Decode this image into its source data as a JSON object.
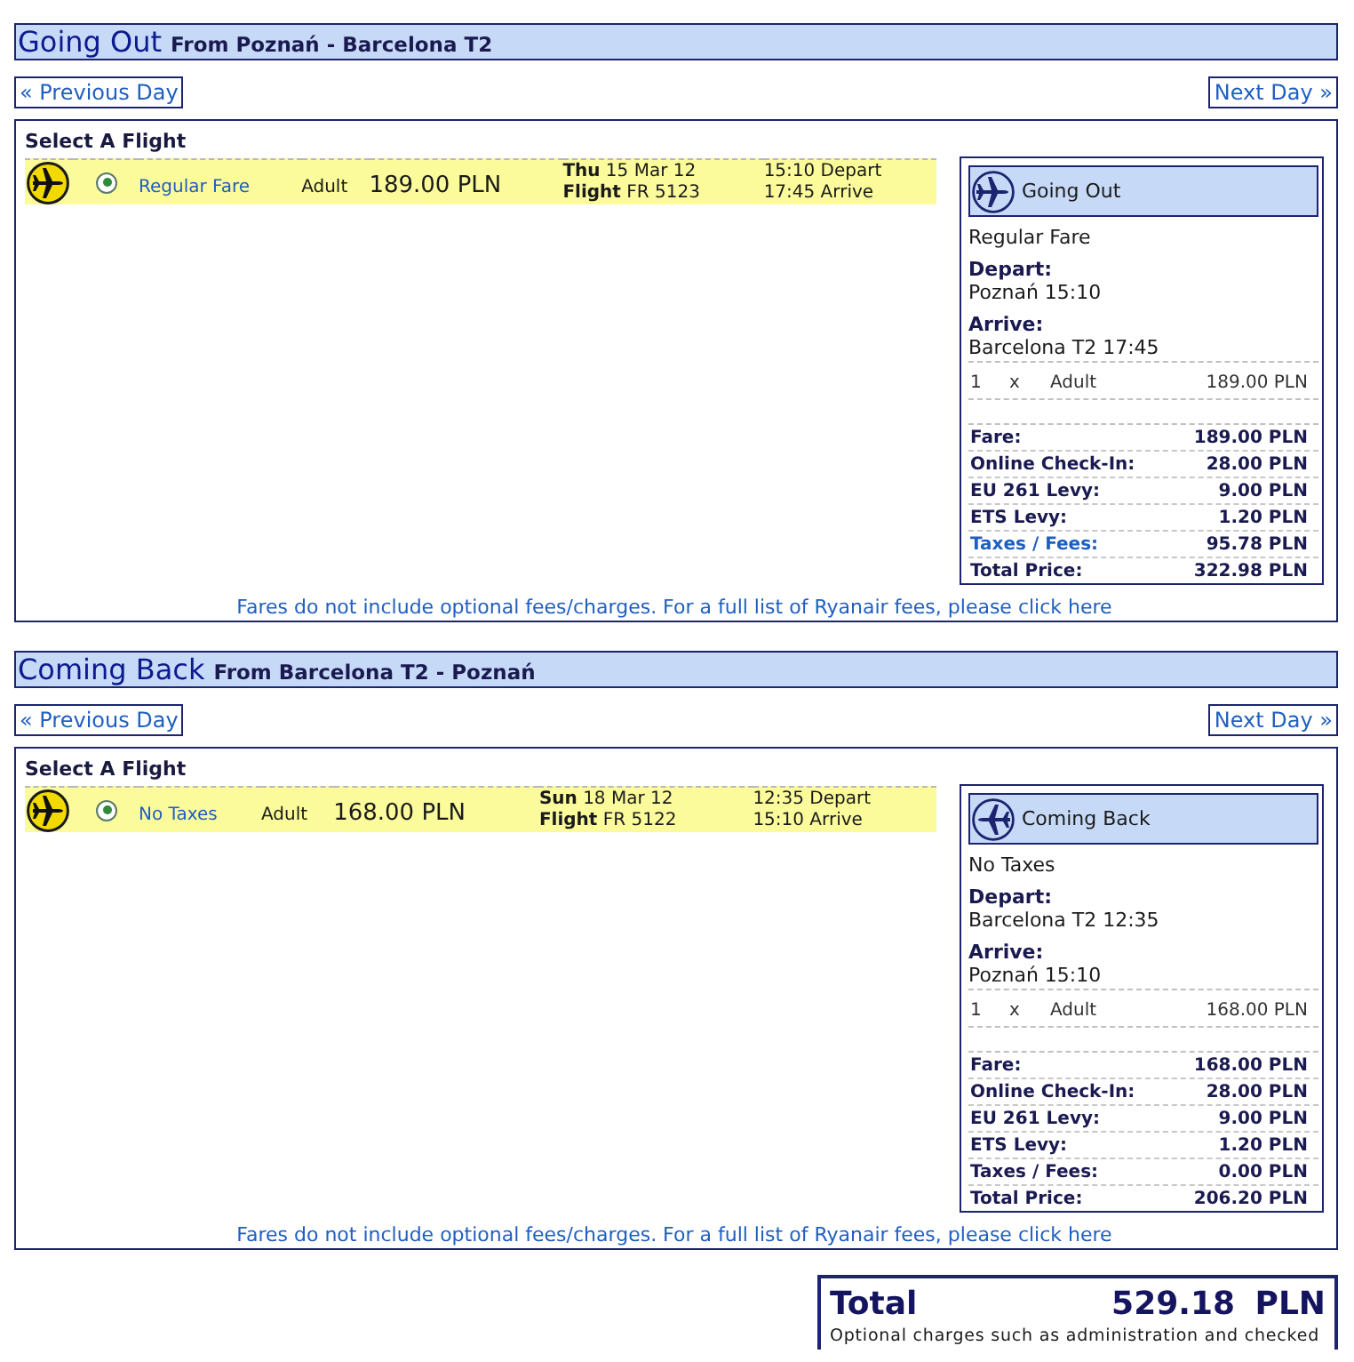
{
  "sections": [
    {
      "plane_mirrored": false,
      "title": "Going Out",
      "route": "From Poznań - Barcelona T2",
      "prev_day": "« Previous Day",
      "next_day": "Next Day »",
      "select_title": "Select A Flight",
      "flights": [
        {
          "selected": true,
          "fare": "Regular Fare",
          "passenger": "Adult",
          "price": "189.00 PLN",
          "date": "**Thu** 15 Mar 12",
          "flight": "**Flight** FR 5123",
          "depart": "15:10 Depart",
          "arrive": "17:45 Arrive"
        }
      ],
      "summary": {
        "title": "Going Out",
        "fare_type": "Regular Fare",
        "depart_label": "Depart:",
        "depart": "Poznań 15:10",
        "arrive_label": "Arrive:",
        "arrive": "Barcelona T2 17:45",
        "passengers": [
          {
            "count": "1",
            "times": "x",
            "type": "Adult",
            "price": "189.00 PLN"
          }
        ],
        "fees": [
          {
            "label": "Fare:",
            "value": "189.00 PLN",
            "link": false
          },
          {
            "label": "Online Check-In:",
            "value": "28.00 PLN",
            "link": false
          },
          {
            "label": "EU 261 Levy:",
            "value": "9.00 PLN",
            "link": false
          },
          {
            "label": "ETS Levy:",
            "value": "1.20 PLN",
            "link": false
          },
          {
            "label": "Taxes / Fees:",
            "value": "95.78 PLN",
            "link": true
          },
          {
            "label": "Total Price:",
            "value": "322.98 PLN",
            "link": false
          }
        ]
      },
      "notice": "Fares do not include optional fees/charges. For a full list of Ryanair fees, please click here"
    },
    {
      "plane_mirrored": true,
      "title": "Coming Back",
      "route": "From Barcelona T2 - Poznań",
      "prev_day": "« Previous Day",
      "next_day": "Next Day »",
      "select_title": "Select A Flight",
      "flights": [
        {
          "selected": true,
          "fare": "No Taxes",
          "passenger": "Adult",
          "price": "168.00 PLN",
          "date": "**Sun** 18 Mar 12",
          "flight": "**Flight** FR 5122",
          "depart": "12:35 Depart",
          "arrive": "15:10 Arrive"
        }
      ],
      "summary": {
        "title": "Coming Back",
        "fare_type": "No Taxes",
        "depart_label": "Depart:",
        "depart": "Barcelona T2 12:35",
        "arrive_label": "Arrive:",
        "arrive": "Poznań 15:10",
        "passengers": [
          {
            "count": "1",
            "times": "x",
            "type": "Adult",
            "price": "168.00 PLN"
          }
        ],
        "fees": [
          {
            "label": "Fare:",
            "value": "168.00 PLN",
            "link": false
          },
          {
            "label": "Online Check-In:",
            "value": "28.00 PLN",
            "link": false
          },
          {
            "label": "EU 261 Levy:",
            "value": "9.00 PLN",
            "link": false
          },
          {
            "label": "ETS Levy:",
            "value": "1.20 PLN",
            "link": false
          },
          {
            "label": "Taxes / Fees:",
            "value": "0.00 PLN",
            "link": false
          },
          {
            "label": "Total Price:",
            "value": "206.20 PLN",
            "link": false
          }
        ]
      },
      "notice": "Fares do not include optional fees/charges. For a full list of Ryanair fees, please click here"
    }
  ],
  "total": {
    "label": "Total",
    "amount": "529.18 PLN",
    "note": "Optional charges such as administration and checked"
  }
}
